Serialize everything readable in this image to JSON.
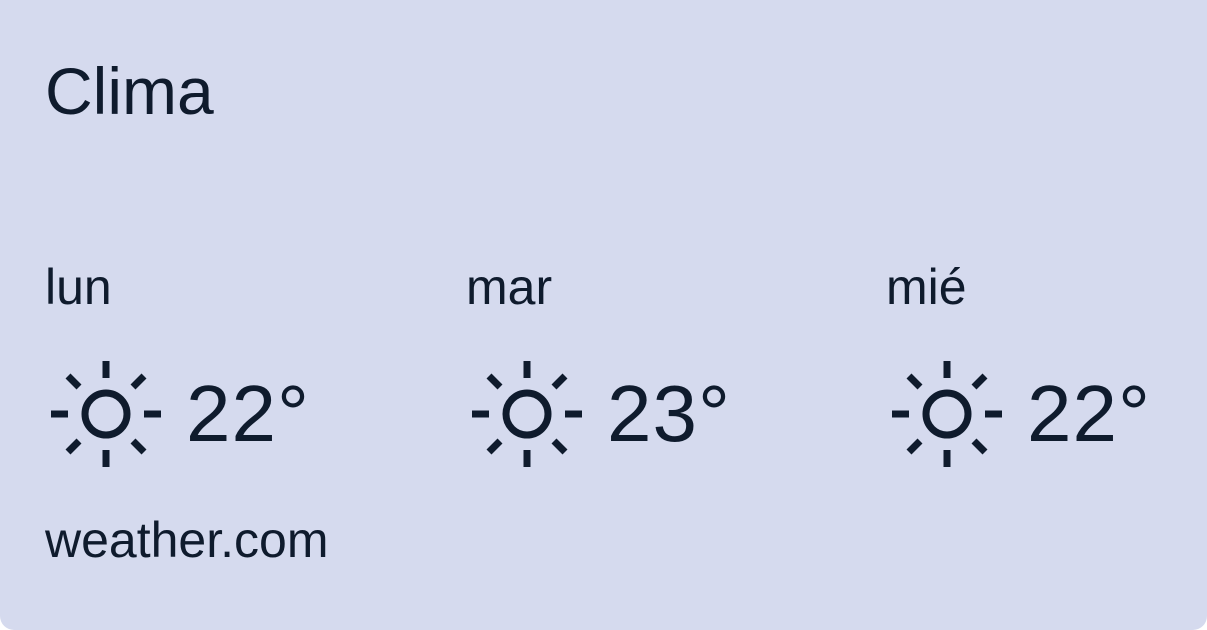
{
  "widget": {
    "title": "Clima",
    "source": "weather.com",
    "forecast": [
      {
        "day": "lun",
        "temp": "22°",
        "icon": "sun-icon"
      },
      {
        "day": "mar",
        "temp": "23°",
        "icon": "sun-icon"
      },
      {
        "day": "mié",
        "temp": "22°",
        "icon": "sun-icon"
      }
    ]
  },
  "colors": {
    "card_background": "#d5daee",
    "text": "#0f1b2d"
  }
}
